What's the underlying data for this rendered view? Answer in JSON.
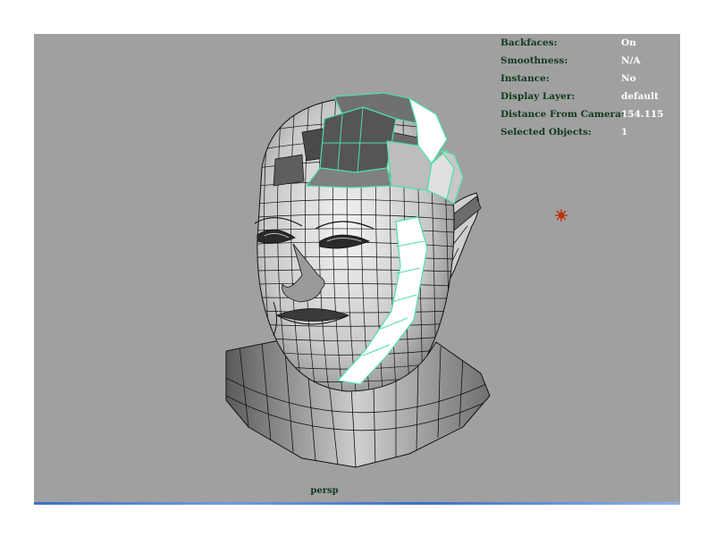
{
  "viewport": {
    "camera_name": "persp",
    "background_color": "#a0a0a0",
    "selection_color": "#4fe0a6",
    "light_icon": "point-light-icon",
    "light_icon_color": "#c0300a"
  },
  "hud": {
    "rows": [
      {
        "label": "Backfaces:",
        "value": "On"
      },
      {
        "label": "Smoothness:",
        "value": "N/A"
      },
      {
        "label": "Instance:",
        "value": "No"
      },
      {
        "label": "Display Layer:",
        "value": "default"
      },
      {
        "label": "Distance From Camera:",
        "value": "154.115"
      },
      {
        "label": "Selected Objects:",
        "value": "1"
      }
    ]
  },
  "scene": {
    "object_icon": "polygon-head-mesh"
  }
}
